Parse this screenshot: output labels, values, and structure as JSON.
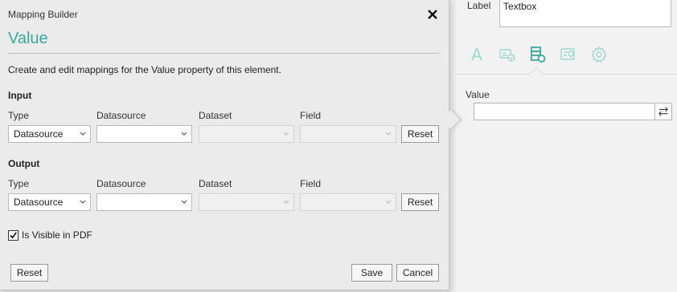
{
  "properties_panel": {
    "label_caption": "Label",
    "label_value": "Textbox",
    "value_caption": "Value",
    "value_input": "",
    "tab_icons": [
      "font-icon",
      "event-icon",
      "data-icon",
      "validation-icon",
      "settings-icon"
    ],
    "active_tab": "data-icon"
  },
  "dialog": {
    "caption": "Mapping Builder",
    "title": "Value",
    "description": "Create and edit mappings for the Value property of this element.",
    "columns": {
      "type": "Type",
      "datasource": "Datasource",
      "dataset": "Dataset",
      "field": "Field"
    },
    "input": {
      "heading": "Input",
      "type_value": "Datasource",
      "datasource_value": "",
      "dataset_value": "",
      "field_value": "",
      "reset_label": "Reset"
    },
    "output": {
      "heading": "Output",
      "type_value": "Datasource",
      "datasource_value": "",
      "dataset_value": "",
      "field_value": "",
      "reset_label": "Reset"
    },
    "visible_in_pdf": {
      "label": "Is Visible in PDF",
      "checked": true
    },
    "footer": {
      "reset_label": "Reset",
      "save_label": "Save",
      "cancel_label": "Cancel"
    }
  },
  "colors": {
    "accent": "#3ba89c",
    "icon_inactive": "#9fd6cf",
    "icon_active": "#3ba89c"
  }
}
